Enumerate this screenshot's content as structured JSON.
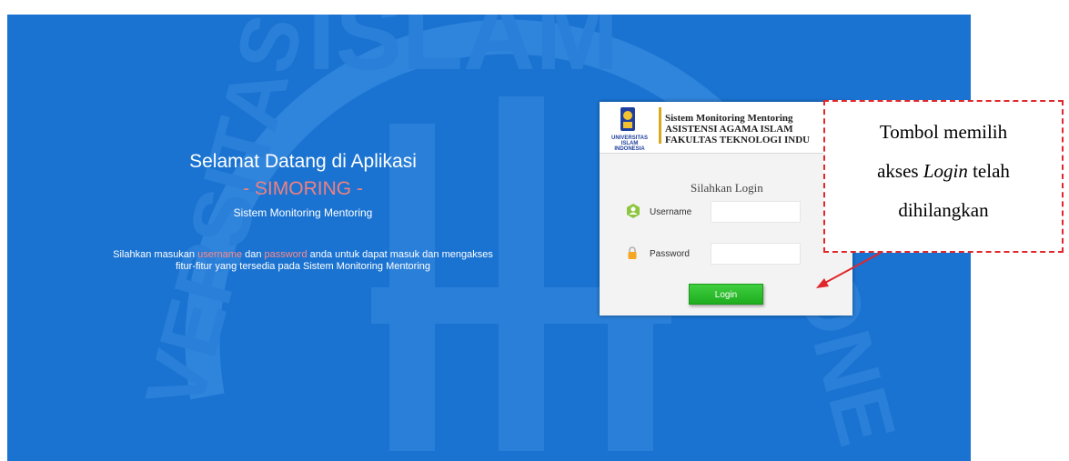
{
  "welcome": {
    "line1": "Selamat Datang di Aplikasi",
    "line2": "- SIMORING -",
    "line3": "Sistem Monitoring Mentoring"
  },
  "info": {
    "part1": "Silahkan masukan ",
    "username_word": "username",
    "part2": " dan ",
    "password_word": "password",
    "part3": " anda untuk dapat masuk dan mengakses",
    "line2": "fitur-fitur yang tersedia pada Sistem Monitoring Mentoring"
  },
  "card": {
    "logo_text": "UNIVERSITAS ISLAM INDONESIA",
    "institution_line1": "Sistem Monitoring Mentoring",
    "institution_line2": "ASISTENSI AGAMA ISLAM",
    "institution_line3": "FAKULTAS TEKNOLOGI INDU",
    "login_title": "Silahkan Login",
    "username_label": "Username",
    "password_label": "Password",
    "login_button": "Login"
  },
  "callout": {
    "line1": "Tombol memilih",
    "line2_pre": "akses ",
    "line2_italic": "Login",
    "line2_post": " telah",
    "line3": "dihilangkan"
  },
  "colors": {
    "background": "#1a73d1",
    "accent_pink": "#f08080",
    "button_green": "#2ebd2e",
    "callout_red": "#e0272b"
  },
  "icons": [
    "user-icon",
    "lock-icon",
    "uii-logo"
  ]
}
